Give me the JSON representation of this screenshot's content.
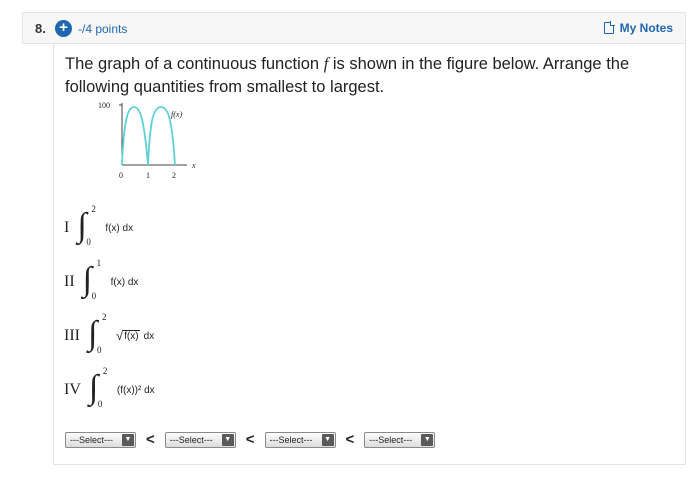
{
  "question": {
    "number": "8.",
    "plus_icon": "+",
    "points": "-/4 points",
    "notes_label": "My Notes",
    "prompt": "The graph of a continuous function f is shown in the figure below. Arrange the following quantities from smallest to largest."
  },
  "graph": {
    "y_tick": "100",
    "curve_label": "f(x)",
    "x_axis_label": "x",
    "x_ticks": [
      "0",
      "1",
      "2"
    ],
    "curve_color": "#5fd0d8"
  },
  "items": [
    {
      "roman": "I",
      "upper": "2",
      "lower": "0",
      "expr": "f(x) dx"
    },
    {
      "roman": "II",
      "upper": "1",
      "lower": "0",
      "expr": "f(x) dx"
    },
    {
      "roman": "III",
      "upper": "2",
      "lower": "0",
      "radicand": "f(x)",
      "suffix": "dx"
    },
    {
      "roman": "IV",
      "upper": "2",
      "lower": "0",
      "expr": "(f(x))² dx"
    }
  ],
  "selects": {
    "placeholder": "---Select---",
    "caret": "▼",
    "separator": "<"
  }
}
